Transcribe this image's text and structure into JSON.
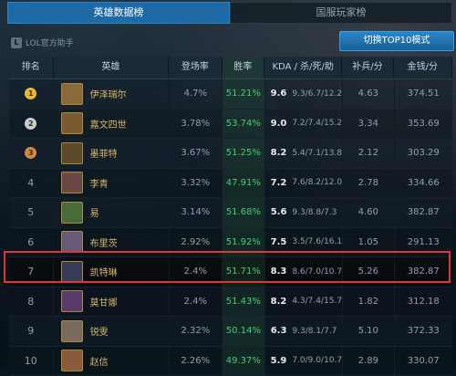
{
  "tabs": [
    {
      "label": "英雄数据榜",
      "active": true
    },
    {
      "label": "国服玩家榜",
      "active": false
    }
  ],
  "brand": {
    "label": "LOL官方助手"
  },
  "top_button": {
    "label": "切换TOP10模式"
  },
  "columns": [
    "排名",
    "英雄",
    "登场率",
    "胜率",
    "KDA / 杀/死/助",
    "补兵/分",
    "金钱/分"
  ],
  "rows": [
    {
      "rank": "1",
      "medal": "gold",
      "hero": "伊泽瑞尔",
      "pick": "4.7%",
      "win": "51.21%",
      "kda": "9.6",
      "kda_detail": "9.3/6.7/12.2",
      "cs": "4.63",
      "gold": "374.51",
      "portrait_color": "#8a6a3a",
      "highlight": false
    },
    {
      "rank": "2",
      "medal": "silver",
      "hero": "嘉文四世",
      "pick": "3.78%",
      "win": "53.74%",
      "kda": "9.0",
      "kda_detail": "7.2/7.4/15.2",
      "cs": "3.34",
      "gold": "353.69",
      "portrait_color": "#7a5a30",
      "highlight": false
    },
    {
      "rank": "3",
      "medal": "bronze",
      "hero": "墨菲特",
      "pick": "3.67%",
      "win": "51.25%",
      "kda": "8.2",
      "kda_detail": "5.4/7.1/13.8",
      "cs": "2.12",
      "gold": "303.29",
      "portrait_color": "#5a4a2a",
      "highlight": false
    },
    {
      "rank": "4",
      "medal": "",
      "hero": "李青",
      "pick": "3.32%",
      "win": "47.91%",
      "kda": "7.2",
      "kda_detail": "7.6/8.2/12.0",
      "cs": "2.78",
      "gold": "334.66",
      "portrait_color": "#6a4848",
      "highlight": false
    },
    {
      "rank": "5",
      "medal": "",
      "hero": "易",
      "pick": "3.14%",
      "win": "51.68%",
      "kda": "5.6",
      "kda_detail": "9.3/8.8/7.3",
      "cs": "4.60",
      "gold": "382.87",
      "portrait_color": "#4a6a3a",
      "highlight": false
    },
    {
      "rank": "6",
      "medal": "",
      "hero": "布里茨",
      "pick": "2.92%",
      "win": "51.92%",
      "kda": "7.5",
      "kda_detail": "3.5/7.6/16.1",
      "cs": "1.05",
      "gold": "291.13",
      "portrait_color": "#6a5a7a",
      "highlight": false
    },
    {
      "rank": "7",
      "medal": "",
      "hero": "凯特琳",
      "pick": "2.4%",
      "win": "51.71%",
      "kda": "8.3",
      "kda_detail": "8.6/7.0/10.7",
      "cs": "5.26",
      "gold": "382.87",
      "portrait_color": "#3a3a5a",
      "highlight": true
    },
    {
      "rank": "8",
      "medal": "",
      "hero": "莫甘娜",
      "pick": "2.4%",
      "win": "51.43%",
      "kda": "8.2",
      "kda_detail": "4.3/7.4/15.7",
      "cs": "1.82",
      "gold": "312.18",
      "portrait_color": "#5a3a6a",
      "highlight": false
    },
    {
      "rank": "9",
      "medal": "",
      "hero": "锐雯",
      "pick": "2.32%",
      "win": "50.14%",
      "kda": "6.3",
      "kda_detail": "9.3/8.1/7.7",
      "cs": "5.10",
      "gold": "372.33",
      "portrait_color": "#7a6a5a",
      "highlight": false
    },
    {
      "rank": "10",
      "medal": "",
      "hero": "赵信",
      "pick": "2.26%",
      "win": "49.37%",
      "kda": "5.9",
      "kda_detail": "7.0/9.0/10.7",
      "cs": "2.89",
      "gold": "330.07",
      "portrait_color": "#8a5a3a",
      "highlight": false
    }
  ],
  "colors": {
    "accent": "#1e6aa6",
    "win_green": "#3fcf73",
    "hero_gold": "#d6b86a",
    "highlight_border": "#d93a36",
    "medal_gold": "#e8b830",
    "medal_silver": "#c8ccd2",
    "medal_bronze": "#d08a40"
  }
}
